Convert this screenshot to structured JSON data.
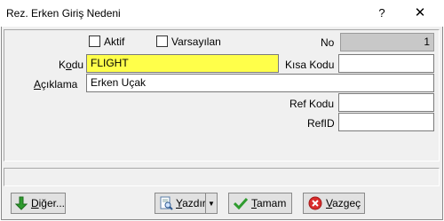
{
  "window": {
    "title": "Rez. Erken Giriş Nedeni",
    "help_label": "?",
    "close_label": "✕"
  },
  "form": {
    "aktif_label": "Aktif",
    "varsayilan_label": "Varsayılan",
    "no_label": "No",
    "no_value": "1",
    "kodu_label_pre": "K",
    "kodu_label_u": "o",
    "kodu_label_post": "du",
    "kodu_value": "FLIGHT",
    "kisa_kodu_label": "Kısa Kodu",
    "kisa_kodu_value": "",
    "aciklama_label_u": "A",
    "aciklama_label_post": "çıklama",
    "aciklama_value": "Erken Uçak",
    "ref_kodu_label": "Ref Kodu",
    "ref_kodu_value": "",
    "refid_label": "RefID",
    "refid_value": ""
  },
  "status": {
    "text": ""
  },
  "buttons": {
    "diger_u": "D",
    "diger_rest": "iğer...",
    "yazdir_u": "Y",
    "yazdir_rest": "azdır",
    "tamam_u": "T",
    "tamam_rest": "amam",
    "vazgec_u": "V",
    "vazgec_rest": "azgeç"
  },
  "colors": {
    "kodu_bg": "#ffff4a",
    "no_bg": "#c8c8c8"
  }
}
